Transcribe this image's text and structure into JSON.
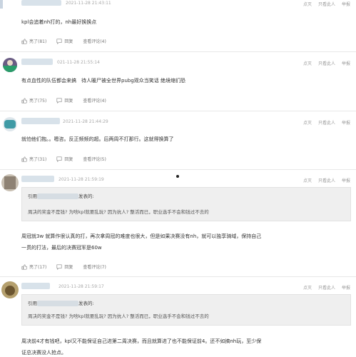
{
  "comments": [
    {
      "time": "2021-11-28 21:43:11",
      "content": "kpl会追着nh打的，nh最好换换点",
      "like": "亮了(81)",
      "reply": "回复",
      "view": "查看评论(4)",
      "actions": [
        "点灭",
        "只看此人",
        "举报"
      ]
    },
    {
      "time": "021-11-28 21:55:14",
      "content": "有点血性的队伍都会来搞　待人暖尸被全世界pubg观众当笑话  绝境缩们恐",
      "like": "亮了(75)",
      "reply": "回复",
      "view": "查看评论(4)",
      "actions": [
        "点灭",
        "只看此人",
        "举报"
      ]
    },
    {
      "time": "2021-11-28 21:44:29",
      "content": "就怕他们抱。。嗯咨。反正频频的超。后两周不打那行。这就得换算了",
      "like": "亮了(31)",
      "reply": "回复",
      "view": "查看评论(5)",
      "actions": [
        "点灭",
        "只看此人",
        "举报"
      ]
    },
    {
      "time": "2021-11-28 21:59:19",
      "quote_head_prefix": "引用",
      "quote_head_suffix": "发表的:",
      "quote_body": "周决的奖金不是钱? 为啥kpl就要乱玩? 因为抗人? 整活而已，职业选手不会和钱过不去的",
      "content_line1": "周冠就3w 就算作很认真的打，再次拿周冠的难度也很大，但是如果决赛没有nh，就可以独享骑域，保持自己",
      "content_line2": "一贯的打法，最后的决赛冠军是60w",
      "like": "亮了(17)",
      "reply": "回复",
      "view": "查看评论(7)",
      "actions": [
        "点灭",
        "只看此人",
        "举报"
      ]
    },
    {
      "time": "2021-11-28 21:59:17",
      "quote_head_prefix": "引用",
      "quote_head_suffix": "发表的:",
      "quote_body": "周决的奖金不是钱? 为啥kpl就要乱玩? 因为抗人? 整活而已，职业选手不会和钱过不去的",
      "content_line1": "周决前4才有钱吧，kpl又不能保证自己进第二周决赛，而且就算进了也不能保证前4。还不如搞nh玩，至少保",
      "content_line2": "证总决赛没人抢点。",
      "actions": [
        "点灭",
        "只看此人",
        "举报"
      ]
    }
  ]
}
